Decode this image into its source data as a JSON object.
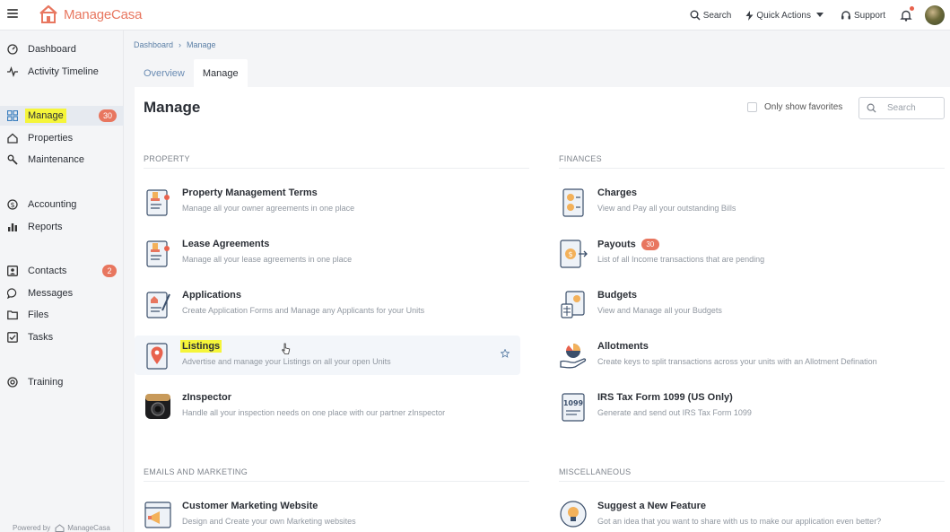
{
  "app": {
    "logo_text_1": "Manage",
    "logo_text_2": "Casa"
  },
  "topbar": {
    "search_label": "Search",
    "quick_actions_label": "Quick Actions",
    "support_label": "Support"
  },
  "sidebar": {
    "items": [
      {
        "label": "Dashboard"
      },
      {
        "label": "Activity Timeline"
      },
      {
        "label": "Manage",
        "badge": "30"
      },
      {
        "label": "Properties"
      },
      {
        "label": "Maintenance"
      },
      {
        "label": "Accounting"
      },
      {
        "label": "Reports"
      },
      {
        "label": "Contacts",
        "badge": "2"
      },
      {
        "label": "Messages"
      },
      {
        "label": "Files"
      },
      {
        "label": "Tasks"
      },
      {
        "label": "Training"
      }
    ],
    "powered_by": "Powered by",
    "powered_brand": "ManageCasa"
  },
  "breadcrumb": {
    "root": "Dashboard",
    "current": "Manage"
  },
  "tabs": [
    {
      "label": "Overview"
    },
    {
      "label": "Manage"
    }
  ],
  "main": {
    "title": "Manage",
    "favorites_label": "Only show favorites",
    "search_placeholder": "Search",
    "sections": {
      "property": "PROPERTY",
      "finances": "FINANCES",
      "emails": "EMAILS AND MARKETING",
      "misc": "MISCELLANEOUS"
    },
    "property_items": [
      {
        "name": "Property Management Terms",
        "desc": "Manage all your owner agreements in one place"
      },
      {
        "name": "Lease Agreements",
        "desc": "Manage all your lease agreements in one place"
      },
      {
        "name": "Applications",
        "desc": "Create Application Forms and Manage any Applicants for your Units"
      },
      {
        "name": "Listings",
        "desc": "Advertise and manage your Listings on all your open Units"
      },
      {
        "name": "zInspector",
        "desc": "Handle all your inspection needs on one place with our partner zInspector"
      }
    ],
    "finance_items": [
      {
        "name": "Charges",
        "desc": "View and Pay all your outstanding Bills"
      },
      {
        "name": "Payouts",
        "badge": "30",
        "desc": "List of all Income transactions that are pending"
      },
      {
        "name": "Budgets",
        "desc": "View and Manage all your Budgets"
      },
      {
        "name": "Allotments",
        "desc": "Create keys to split transactions across your units with an Allotment Defination"
      },
      {
        "name": "IRS Tax Form 1099 (US Only)",
        "desc": "Generate and send out IRS Tax Form 1099"
      }
    ],
    "email_items": [
      {
        "name": "Customer Marketing Website",
        "desc": "Design and Create your own Marketing websites"
      }
    ],
    "misc_items": [
      {
        "name": "Suggest a New Feature",
        "desc": "Got an idea that you want to share with us to make our application even better?"
      }
    ],
    "irs_icon_text": "1099"
  },
  "colors": {
    "accent": "#e8765f",
    "link": "#5b7fa6",
    "highlight": "#f5f53a"
  }
}
